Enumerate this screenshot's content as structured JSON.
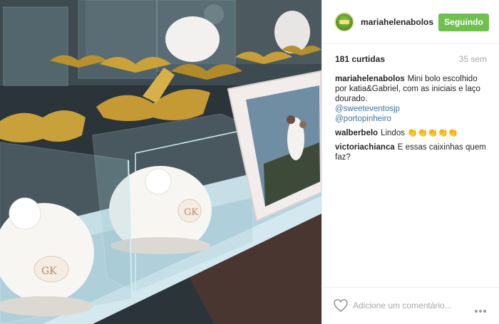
{
  "post": {
    "username": "mariahelenabolos",
    "follow_label": "Seguindo",
    "likes": "181 curtidas",
    "time_ago": "35 sem",
    "caption_user": "mariahelenabolos",
    "caption_text": "Mini bolo escolhido por katia&Gabriel, com as iniciais e laço dourado.",
    "caption_mentions": [
      "@sweeteventosjp",
      "@portopinheiro"
    ],
    "comments": [
      {
        "user": "walberbelo",
        "text": "Lindos 👏👏👏👏👏"
      },
      {
        "user": "victoriachianca",
        "text": "E essas caixinhas quem faz?"
      }
    ],
    "comment_placeholder": "Adicione um comentário...",
    "cake_monogram": "GK",
    "colors": {
      "follow_button": "#70c050",
      "mention": "#3f729b",
      "muted": "#a5a7aa"
    }
  }
}
